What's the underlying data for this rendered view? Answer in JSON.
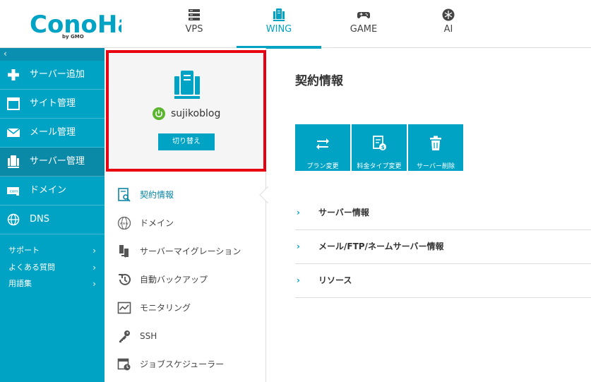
{
  "brand": {
    "logo_text": "ConoHa",
    "logo_sub": "by GMO",
    "accent": "#00a3c4",
    "highlight": "#e60012"
  },
  "topnav": [
    {
      "label": "VPS",
      "icon": "server-rack-icon"
    },
    {
      "label": "WING",
      "icon": "wing-server-icon",
      "active": true
    },
    {
      "label": "GAME",
      "icon": "gamepad-icon"
    },
    {
      "label": "AI",
      "icon": "ai-snowflake-icon"
    }
  ],
  "sidebar": {
    "collapse_label": "‹",
    "items": [
      {
        "label": "サーバー追加",
        "icon": "plus-icon"
      },
      {
        "label": "サイト管理",
        "icon": "site-window-icon"
      },
      {
        "label": "メール管理",
        "icon": "mail-icon"
      },
      {
        "label": "サーバー管理",
        "icon": "server-icon",
        "active": true
      },
      {
        "label": "ドメイン",
        "icon": "domain-com-icon"
      },
      {
        "label": "DNS",
        "icon": "globe-icon"
      }
    ],
    "links": [
      {
        "label": "サポート",
        "chevron": "›"
      },
      {
        "label": "よくある質問",
        "chevron": "›"
      },
      {
        "label": "用語集",
        "chevron": "›"
      }
    ]
  },
  "server_card": {
    "name": "sujikoblog",
    "switch_label": "切り替え",
    "status": "on"
  },
  "midmenu": [
    {
      "label": "契約情報",
      "icon": "contract-search-icon",
      "active": true
    },
    {
      "label": "ドメイン",
      "icon": "www-globe-icon"
    },
    {
      "label": "サーバーマイグレーション",
      "icon": "migration-icon"
    },
    {
      "label": "自動バックアップ",
      "icon": "backup-history-icon"
    },
    {
      "label": "モニタリング",
      "icon": "monitoring-chart-icon"
    },
    {
      "label": "SSH",
      "icon": "key-icon"
    },
    {
      "label": "ジョブスケジューラー",
      "icon": "scheduler-icon"
    }
  ],
  "main": {
    "title": "契約情報",
    "actions": [
      {
        "label": "プラン変更",
        "icon": "swap-arrows-icon"
      },
      {
        "label": "料金タイプ変更",
        "icon": "billing-icon"
      },
      {
        "label": "サーバー削除",
        "icon": "trash-icon"
      }
    ],
    "sections": [
      {
        "label": "サーバー情報",
        "chevron": "›"
      },
      {
        "label": "メール/FTP/ネームサーバー情報",
        "chevron": "›"
      },
      {
        "label": "リソース",
        "chevron": "›"
      }
    ]
  }
}
